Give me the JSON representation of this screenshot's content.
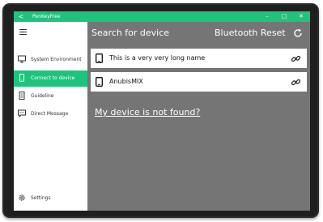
{
  "window": {
    "title": "PenKeyFree",
    "back_glyph": "<",
    "min_glyph": "–",
    "max_glyph": "□",
    "close_glyph": "✕"
  },
  "sidebar": {
    "items": [
      {
        "label": "System Environment",
        "icon": "monitor-icon"
      },
      {
        "label": "Connect to device",
        "icon": "phone-icon",
        "active": true
      },
      {
        "label": "Guideline",
        "icon": "document-icon"
      },
      {
        "label": "Direct Message",
        "icon": "chat-icon"
      }
    ],
    "settings_label": "Settings"
  },
  "main": {
    "title": "Search for device",
    "bt_reset_label": "Bluetooth Reset",
    "devices": [
      {
        "name": "This is a very very long name"
      },
      {
        "name": "AnubisMIX"
      }
    ],
    "not_found_link": "My device is not found?"
  },
  "colors": {
    "accent": "#1ec47c",
    "main_bg": "#757575",
    "bezel": "#2b2b2b"
  }
}
